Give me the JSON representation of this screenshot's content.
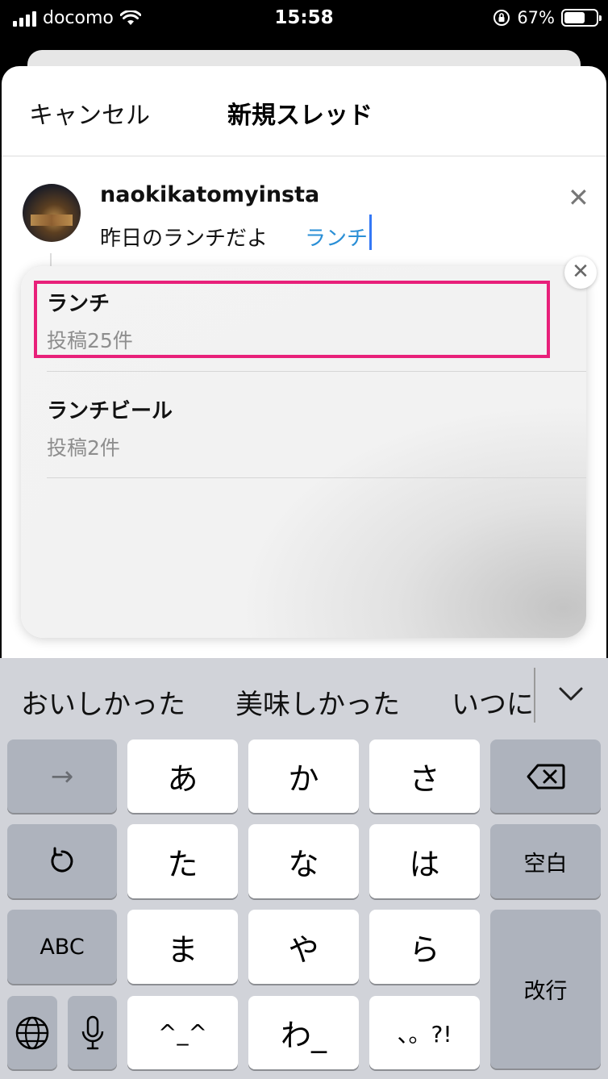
{
  "status_bar": {
    "carrier": "docomo",
    "time": "15:58",
    "battery_percent": "67%",
    "battery_level": 0.67
  },
  "nav": {
    "cancel": "キャンセル",
    "title": "新規スレッド"
  },
  "post": {
    "username": "naokikatomyinsta",
    "text": "昨日のランチだよ",
    "tag": "ランチ",
    "close": "✕"
  },
  "suggestions": {
    "close": "✕",
    "items": [
      {
        "name": "ランチ",
        "count": "投稿25件"
      },
      {
        "name": "ランチビール",
        "count": "投稿2件"
      }
    ]
  },
  "keyboard": {
    "candidates": [
      "おいしかった",
      "美味しかった",
      "いつに"
    ],
    "chevron": "⌄",
    "keys": {
      "arrow": "→",
      "a": "あ",
      "ka": "か",
      "sa": "さ",
      "backspace": "⌫",
      "undo": "↺",
      "ta": "た",
      "na": "な",
      "ha": "は",
      "space": "空白",
      "abc": "ABC",
      "ma": "ま",
      "ya": "や",
      "ra": "ら",
      "return": "改行",
      "globe": "🌐",
      "mic": "🎤",
      "kaomoji": "^_^",
      "wa": "わ_",
      "punct": "、。?!"
    }
  }
}
